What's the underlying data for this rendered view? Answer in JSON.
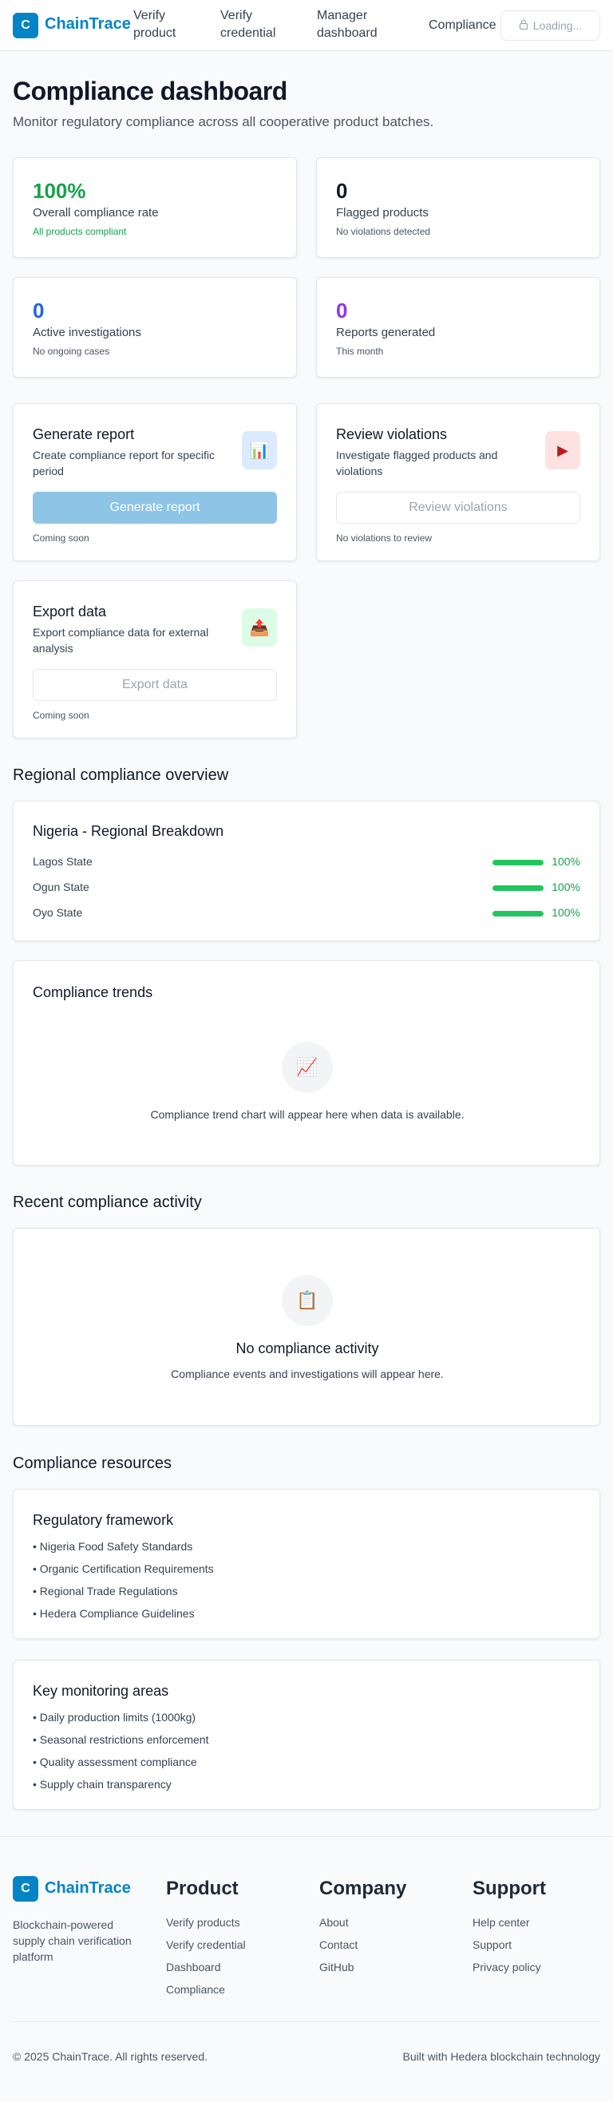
{
  "header": {
    "logo_letter": "C",
    "logo_text": "ChainTrace",
    "nav": [
      {
        "line1": "Verify",
        "line2": "product"
      },
      {
        "line1": "Verify",
        "line2": "credential"
      },
      {
        "line1": "Manager",
        "line2": "dashboard"
      },
      {
        "line1": "Compliance",
        "line2": ""
      }
    ],
    "loading_label": "Loading..."
  },
  "hero": {
    "title": "Compliance dashboard",
    "subtitle": "Monitor regulatory compliance across all cooperative product batches."
  },
  "stats": [
    {
      "value": "100%",
      "label": "Overall compliance rate",
      "note": "All products compliant",
      "color": "#16a34a",
      "note_color": "#16a34a"
    },
    {
      "value": "0",
      "label": "Flagged products",
      "note": "No violations detected",
      "color": "#111827",
      "note_color": "#4b5563"
    },
    {
      "value": "0",
      "label": "Active investigations",
      "note": "No ongoing cases",
      "color": "#2563eb",
      "note_color": "#4b5563"
    },
    {
      "value": "0",
      "label": "Reports generated",
      "note": "This month",
      "color": "#9333ea",
      "note_color": "#4b5563"
    }
  ],
  "actions": [
    {
      "title": "Generate report",
      "desc": "Create compliance report for specific period",
      "button": "Generate report",
      "note": "Coming soon",
      "icon": "bar-chart-icon",
      "icon_glyph": "📊",
      "icon_bg": "#dbeafe"
    },
    {
      "title": "Review violations",
      "desc": "Investigate flagged products and violations",
      "button": "Review violations",
      "note": "No violations to review",
      "icon": "flag-icon",
      "icon_glyph": "▶",
      "icon_bg": "#fee2e2"
    },
    {
      "title": "Export data",
      "desc": "Export compliance data for external analysis",
      "button": "Export data",
      "note": "Coming soon",
      "icon": "export-icon",
      "icon_glyph": "📤",
      "icon_bg": "#dcfce7"
    }
  ],
  "regional": {
    "section_title": "Regional compliance overview",
    "card_title": "Nigeria - Regional Breakdown",
    "rows": [
      {
        "name": "Lagos State",
        "pct": "100%",
        "level": 1.0
      },
      {
        "name": "Ogun State",
        "pct": "100%",
        "level": 1.0
      },
      {
        "name": "Oyo State",
        "pct": "100%",
        "level": 1.0
      }
    ]
  },
  "trends": {
    "title": "Compliance trends",
    "icon": "trend-chart-icon",
    "icon_glyph": "📈",
    "empty_text": "Compliance trend chart will appear here when data is available."
  },
  "activity": {
    "section_title": "Recent compliance activity",
    "icon": "clipboard-icon",
    "icon_glyph": "📋",
    "empty_title": "No compliance activity",
    "empty_text": "Compliance events and investigations will appear here."
  },
  "resources": {
    "section_title": "Compliance resources",
    "cards": [
      {
        "title": "Regulatory framework",
        "items": [
          "• Nigeria Food Safety Standards",
          "• Organic Certification Requirements",
          "• Regional Trade Regulations",
          "• Hedera Compliance Guidelines"
        ]
      },
      {
        "title": "Key monitoring areas",
        "items": [
          "• Daily production limits (1000kg)",
          "• Seasonal restrictions enforcement",
          "• Quality assessment compliance",
          "• Supply chain transparency"
        ]
      }
    ]
  },
  "footer": {
    "logo_letter": "C",
    "logo_text": "ChainTrace",
    "desc": "Blockchain-powered supply chain verification platform",
    "columns": [
      {
        "title": "Product",
        "links": [
          "Verify products",
          "Verify credential",
          "Dashboard",
          "Compliance"
        ]
      },
      {
        "title": "Company",
        "links": [
          "About",
          "Contact",
          "GitHub"
        ]
      },
      {
        "title": "Support",
        "links": [
          "Help center",
          "Support",
          "Privacy policy"
        ]
      }
    ],
    "copyright": "© 2025 ChainTrace. All rights reserved.",
    "built_with": "Built with Hedera blockchain technology"
  },
  "colors": {
    "brand": "#0284c7",
    "success": "#16a34a",
    "primary_button_disabled": "#8ec5e6"
  }
}
